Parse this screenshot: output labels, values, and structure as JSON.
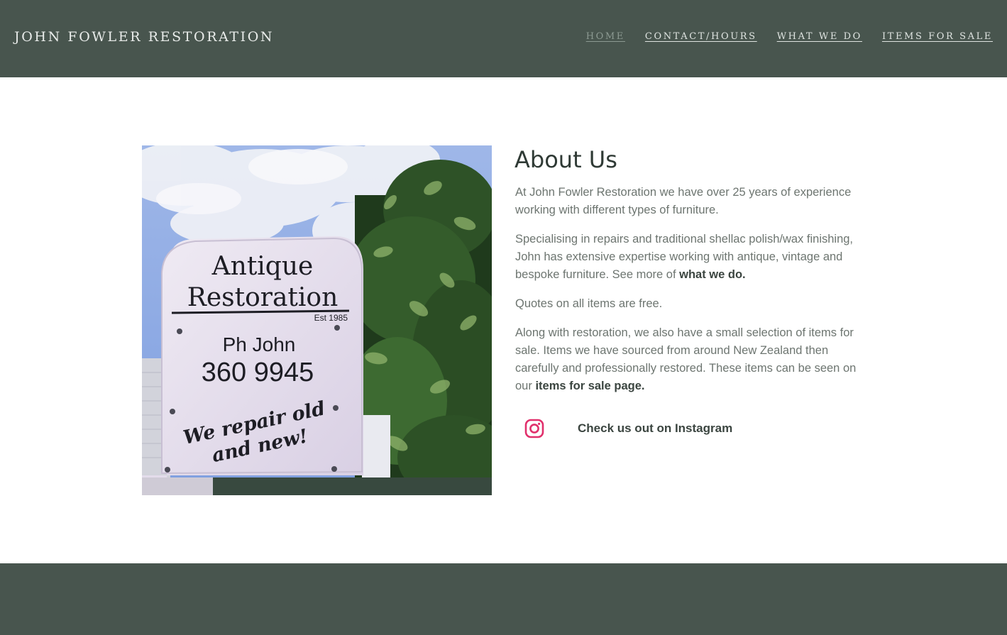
{
  "brand": {
    "name": "JOHN FOWLER RESTORATION"
  },
  "nav": {
    "items": [
      {
        "label": "HOME",
        "active": true
      },
      {
        "label": "CONTACT/HOURS",
        "active": false
      },
      {
        "label": "WHAT WE DO",
        "active": false
      },
      {
        "label": "ITEMS FOR SALE",
        "active": false
      }
    ]
  },
  "photo": {
    "sign_line1": "Antique",
    "sign_line2": "Restoration",
    "sign_est": "Est 1985",
    "sign_phone_label": "Ph John",
    "sign_phone": "360 9945",
    "sign_slogan1": "We repair old",
    "sign_slogan2": "and new!"
  },
  "about": {
    "heading": "About Us",
    "p1": "At John Fowler Restoration we have over 25 years of experience working with different types of furniture.",
    "p2_text": "Specialising in repairs and traditional shellac polish/wax finishing, John has extensive expertise working with antique, vintage and bespoke furniture. See more of ",
    "p2_link": "what we do.",
    "p3": "Quotes on all items are free.",
    "p4_text": "Along with restoration, we also have a small selection of items for sale. Items we have sourced from around New Zealand then carefully and professionally restored. These items can be seen on our ",
    "p4_link": "items for sale page."
  },
  "instagram": {
    "icon": "instagram-icon",
    "label": "Check us out on Instagram",
    "color": "#e1306c"
  },
  "colors": {
    "header_bg": "#48554e",
    "footer_bg": "#48554e",
    "heading": "#2f3a35",
    "body_text": "#6d7570"
  }
}
